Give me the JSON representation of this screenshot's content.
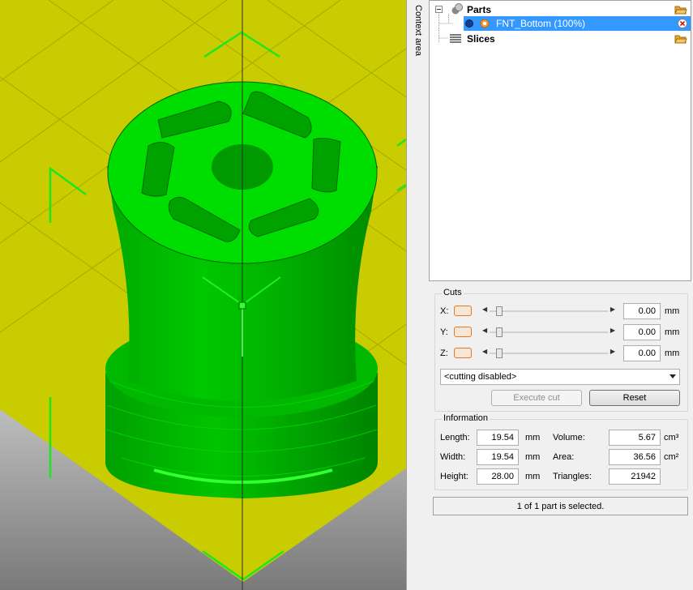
{
  "context_area_label": "Context area",
  "tree": {
    "parts_label": "Parts",
    "part_item_label": "FNT_Bottom (100%)",
    "slices_label": "Slices"
  },
  "cuts": {
    "title": "Cuts",
    "x_label": "X:",
    "y_label": "Y:",
    "z_label": "Z:",
    "x_value": "0.00",
    "y_value": "0.00",
    "z_value": "0.00",
    "unit": "mm",
    "mode_select": "<cutting disabled>",
    "execute_label": "Execute cut",
    "reset_label": "Reset"
  },
  "info": {
    "title": "Information",
    "length_label": "Length:",
    "length_value": "19.54",
    "width_label": "Width:",
    "width_value": "19.54",
    "height_label": "Height:",
    "height_value": "28.00",
    "unit_mm": "mm",
    "volume_label": "Volume:",
    "volume_value": "5.67",
    "volume_unit": "cm³",
    "area_label": "Area:",
    "area_value": "36.56",
    "area_unit": "cm²",
    "triangles_label": "Triangles:",
    "triangles_value": "21942"
  },
  "status": "1 of 1 part is selected.",
  "colors": {
    "bed": "#c9cc00",
    "model": "#00cc00",
    "grid": "#00e000",
    "selection": "#3399ff"
  }
}
